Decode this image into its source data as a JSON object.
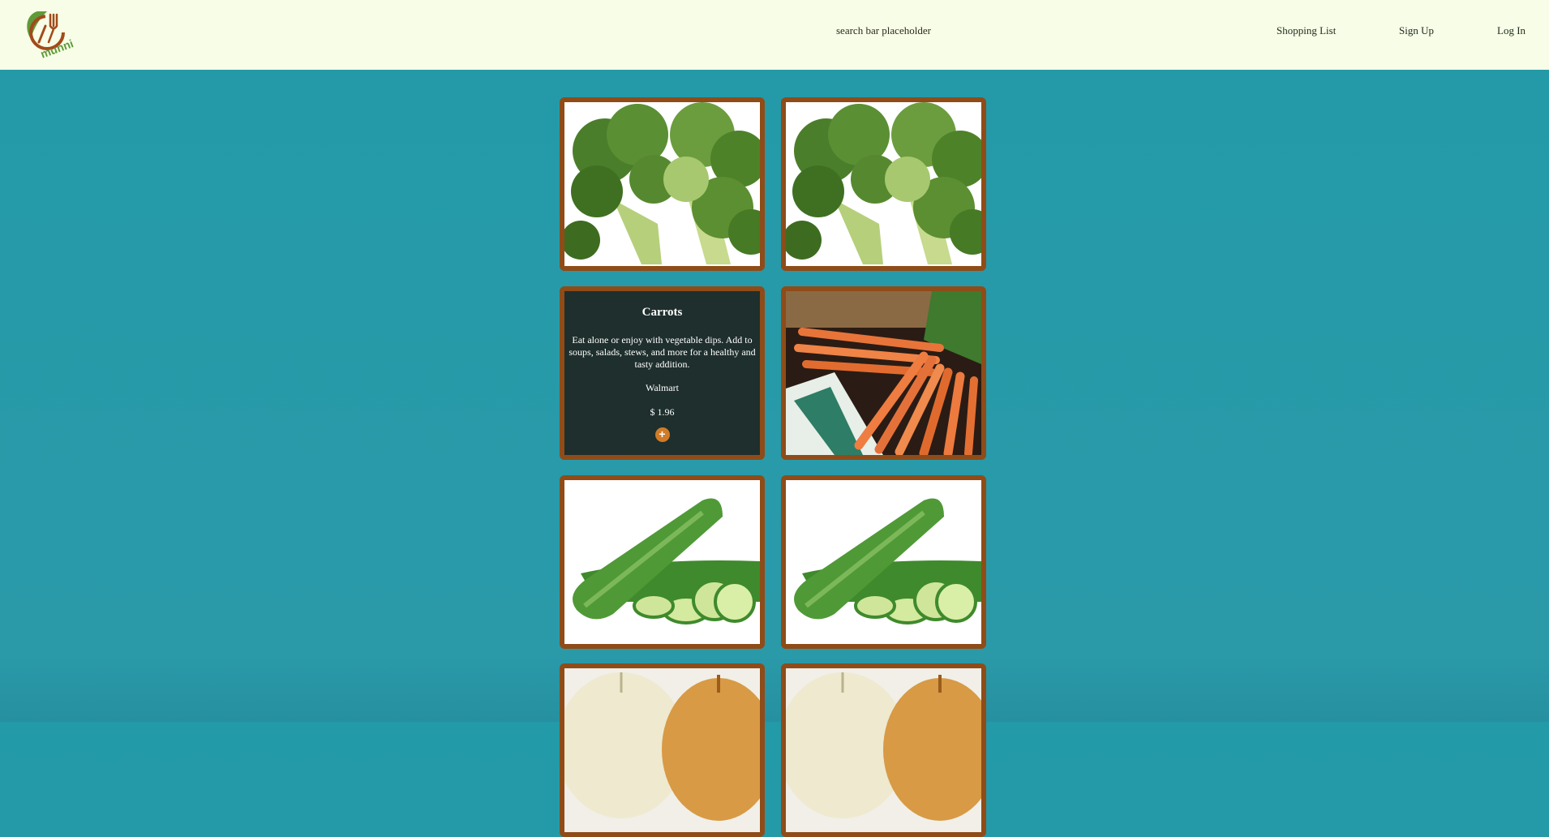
{
  "header": {
    "logo_text": "munni",
    "search_placeholder": "search bar placeholder",
    "nav": {
      "shopping_list": "Shopping List",
      "sign_up": "Sign Up",
      "log_in": "Log In"
    }
  },
  "products": [
    {
      "image": "broccoli-image"
    },
    {
      "image": "broccoli-image"
    },
    {
      "title": "Carrots",
      "description": "Eat alone or enjoy with vegetable dips. Add to soups, salads, stews, and more for a healthy and tasty addition.",
      "store": "Walmart",
      "price": "$ 1.96",
      "add_label": "+"
    },
    {
      "image": "carrots-image"
    },
    {
      "image": "cucumber-image"
    },
    {
      "image": "cucumber-image"
    },
    {
      "image": "onion-image"
    },
    {
      "image": "onion-image"
    }
  ],
  "colors": {
    "header_bg": "#f7fde6",
    "page_bg": "#239aa8",
    "card_border": "#8f4c18",
    "info_bg": "#1e2f2d",
    "add_button": "#d07b27"
  }
}
